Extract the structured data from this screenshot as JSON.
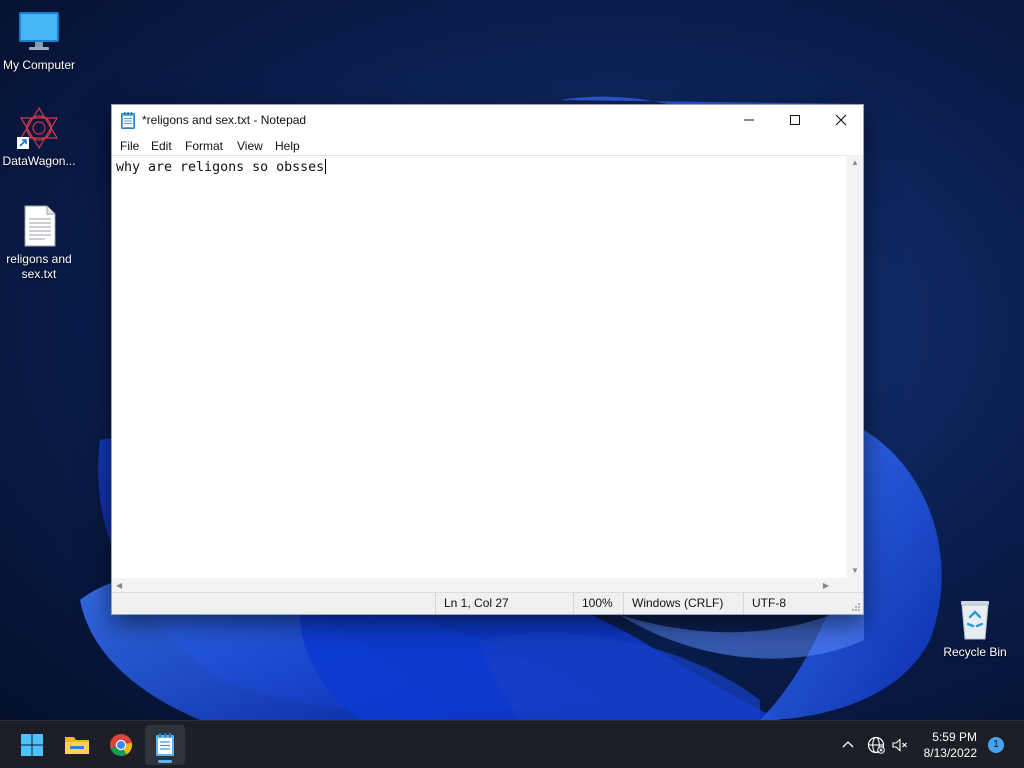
{
  "desktop": {
    "icons": [
      {
        "label": "My Computer"
      },
      {
        "label": "DataWagon..."
      },
      {
        "label": "religons and sex.txt"
      },
      {
        "label": "Recycle Bin"
      }
    ]
  },
  "notepad": {
    "title": "*religons and sex.txt - Notepad",
    "menu": [
      "File",
      "Edit",
      "Format",
      "View",
      "Help"
    ],
    "content": "why are religons so obsses",
    "status": {
      "position": "Ln 1, Col 27",
      "zoom": "100%",
      "line_ending": "Windows (CRLF)",
      "encoding": "UTF-8"
    }
  },
  "taskbar": {
    "time": "5:59 PM",
    "date": "8/13/2022",
    "notification_count": "1",
    "pinned": [
      "start-icon",
      "file-explorer-icon",
      "chrome-icon",
      "notepad-icon"
    ]
  },
  "colors": {
    "accent": "#5fb2f2",
    "taskbar": "#1c1f26"
  }
}
